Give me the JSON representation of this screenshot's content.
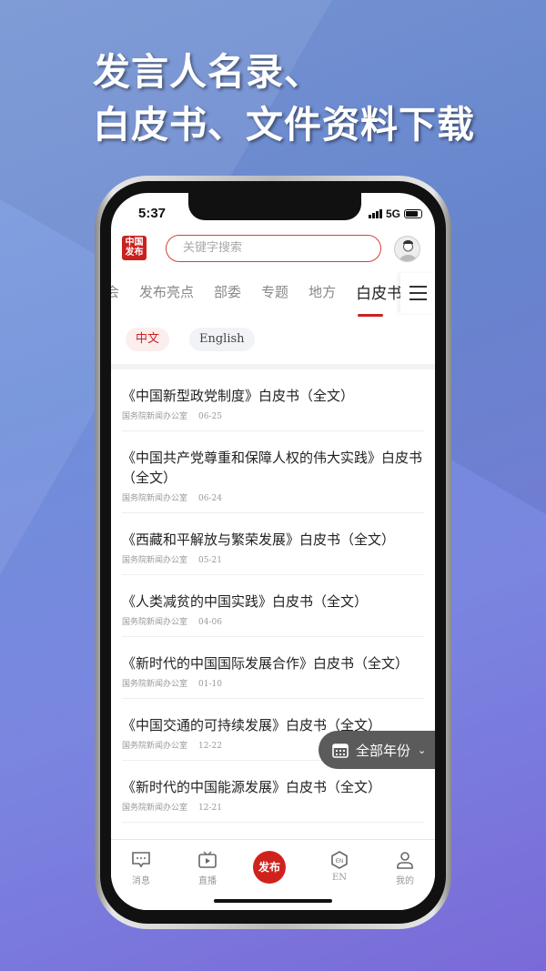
{
  "headline": {
    "line1": "发言人名录、",
    "line2": "白皮书、文件资料下载"
  },
  "status": {
    "time": "5:37",
    "network": "5G"
  },
  "header": {
    "logo_text": "中国发布",
    "search_placeholder": "关键字搜索"
  },
  "tabs": [
    {
      "label": "会"
    },
    {
      "label": "发布亮点"
    },
    {
      "label": "部委"
    },
    {
      "label": "专题"
    },
    {
      "label": "地方"
    },
    {
      "label": "白皮书",
      "active": true
    }
  ],
  "languages": [
    {
      "label": "中文",
      "active": true
    },
    {
      "label": "English"
    }
  ],
  "items": [
    {
      "title": "《中国新型政党制度》白皮书（全文）",
      "source": "国务院新闻办公室",
      "date": "06-25"
    },
    {
      "title": "《中国共产党尊重和保障人权的伟大实践》白皮书（全文）",
      "source": "国务院新闻办公室",
      "date": "06-24"
    },
    {
      "title": "《西藏和平解放与繁荣发展》白皮书（全文）",
      "source": "国务院新闻办公室",
      "date": "05-21"
    },
    {
      "title": "《人类减贫的中国实践》白皮书（全文）",
      "source": "国务院新闻办公室",
      "date": "04-06"
    },
    {
      "title": "《新时代的中国国际发展合作》白皮书（全文）",
      "source": "国务院新闻办公室",
      "date": "01-10"
    },
    {
      "title": "《中国交通的可持续发展》白皮书（全文）",
      "source": "国务院新闻办公室",
      "date": "12-22"
    },
    {
      "title": "《新时代的中国能源发展》白皮书（全文）",
      "source": "国务院新闻办公室",
      "date": "12-21"
    }
  ],
  "year_filter": {
    "label": "全部年份"
  },
  "nav": {
    "messages": "消息",
    "live": "直播",
    "publish": "发布",
    "en": "EN",
    "mine": "我的"
  },
  "colors": {
    "accent": "#c9211e",
    "fab": "#5b5b5b"
  }
}
